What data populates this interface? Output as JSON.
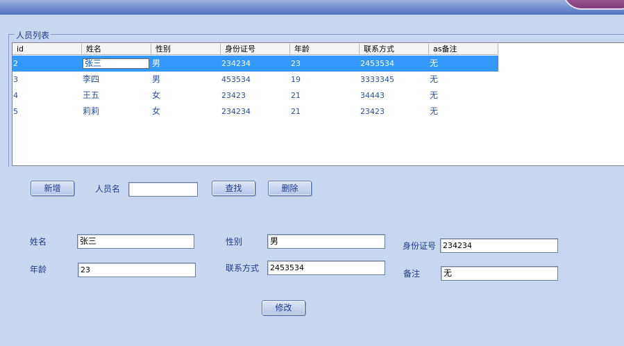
{
  "group_title": "人员列表",
  "table": {
    "headers": [
      "id",
      "姓名",
      "性别",
      "身份证号",
      "年龄",
      "联系方式",
      "as备注"
    ],
    "rows": [
      {
        "id": "2",
        "name": "张三",
        "gender": "男",
        "idno": "234234",
        "age": "23",
        "contact": "2453534",
        "remark": "无",
        "selected": true
      },
      {
        "id": "3",
        "name": "李四",
        "gender": "男",
        "idno": "453534",
        "age": "19",
        "contact": "3333345",
        "remark": "无"
      },
      {
        "id": "4",
        "name": "王五",
        "gender": "女",
        "idno": "23423",
        "age": "21",
        "contact": "34443",
        "remark": "无"
      },
      {
        "id": "5",
        "name": "莉莉",
        "gender": "女",
        "idno": "234234",
        "age": "21",
        "contact": "23423",
        "remark": "无"
      }
    ]
  },
  "toolbar": {
    "add_label": "新增",
    "search_label": "人员名",
    "search_value": "",
    "find_label": "查找",
    "delete_label": "删除"
  },
  "form": {
    "name_label": "姓名",
    "name_value": "张三",
    "gender_label": "性别",
    "gender_value": "男",
    "idno_label": "身份证号",
    "idno_value": "234234",
    "age_label": "年龄",
    "age_value": "23",
    "contact_label": "联系方式",
    "contact_value": "2453534",
    "remark_label": "备注",
    "remark_value": "无",
    "modify_label": "修改"
  }
}
